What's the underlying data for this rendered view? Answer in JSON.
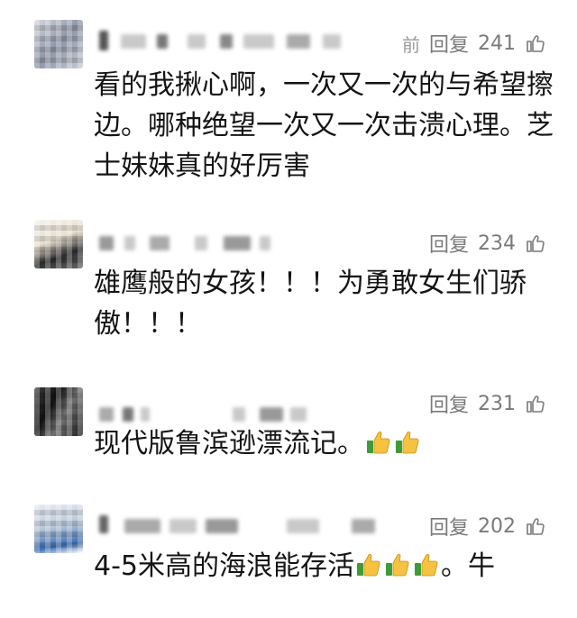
{
  "comments": [
    {
      "time": "前",
      "reply": "回复",
      "likes": "241",
      "text": "看的我揪心啊，一次又一次的与希望擦边。哪种绝望一次又一次击溃心理。芝士妹妹真的好厉害",
      "emoji_count": 0
    },
    {
      "reply": "回复",
      "likes": "234",
      "text": "雄鹰般的女孩！！！为勇敢女生们骄傲！！！",
      "emoji_count": 0
    },
    {
      "reply": "回复",
      "likes": "231",
      "text": "现代版鲁滨逊漂流记。",
      "emoji": "thumbs-up-icon",
      "emoji_count": 2
    },
    {
      "reply": "回复",
      "likes": "202",
      "text": "4-5米高的海浪能存活",
      "text_after": "。牛",
      "emoji": "thumbs-up-icon",
      "emoji_count": 3
    }
  ],
  "colors": {
    "text": "#141414",
    "meta": "#7a7a7a",
    "thumb_yellow": "#f5c242",
    "thumb_green": "#3f9b3a"
  }
}
